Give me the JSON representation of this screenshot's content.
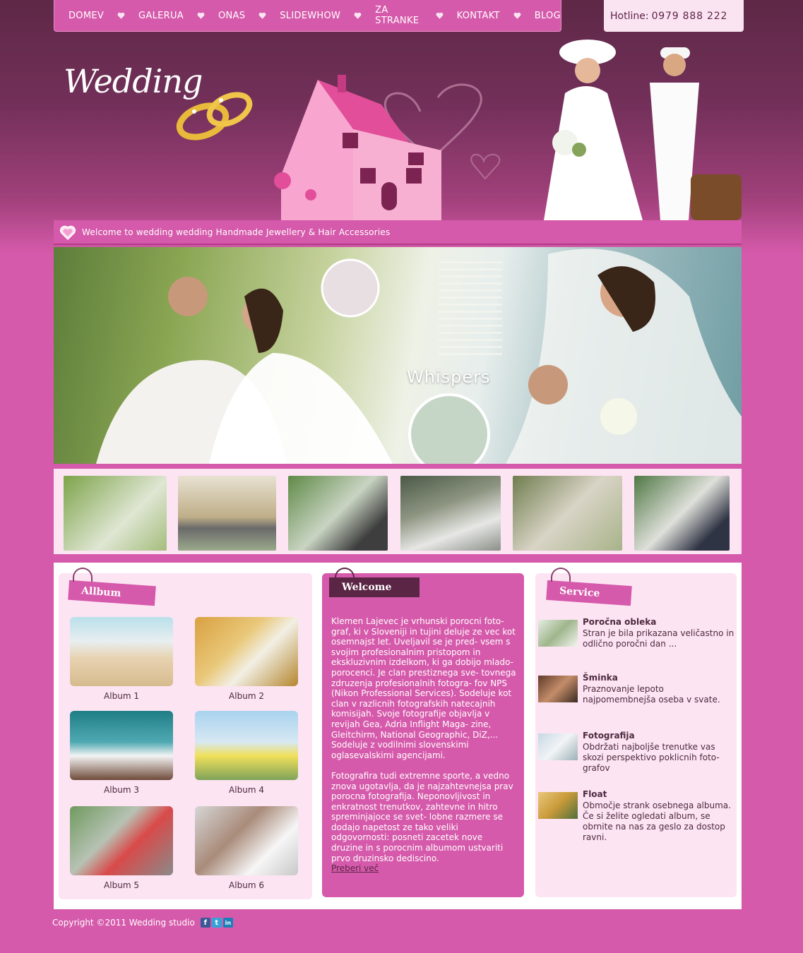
{
  "nav": {
    "items": [
      "DOMEV",
      "GALERUA",
      "ONAS",
      "SLIDEWHOW",
      "ZA STRANKE",
      "KONTAKT",
      "BLOG"
    ]
  },
  "hotline": {
    "label": "Hotline:",
    "number": "0979 888 222"
  },
  "header": {
    "logo": "Wedding"
  },
  "welcome_bar": {
    "text": "Welcome to wedding wedding Handmade Jewellery & Hair Accessories"
  },
  "banner": {
    "title": "Whispers"
  },
  "album": {
    "heading": "Allbum",
    "items": [
      {
        "label": "Album 1"
      },
      {
        "label": "Album 2"
      },
      {
        "label": "Album 3"
      },
      {
        "label": "Album 4"
      },
      {
        "label": "Album 5"
      },
      {
        "label": "Album 6"
      }
    ]
  },
  "welcome": {
    "heading": "Welcome",
    "paragraph1": "Klemen Lajevec je vrhunski porocni foto- graf, ki v Sloveniji in tujini deluje ze vec kot osemnajst let. Uveljavil se je pred- vsem s svojim profesionalnim pristopom in ekskluzivnim izdelkom, ki ga dobijo mlado- porocenci. Je clan prestiznega sve- tovnega zdruzenja profesionalnih fotogra- fov NPS (Nikon Professional Services). Sodeluje kot clan v razlicnih fotografskih natecajnih komisijah. Svoje fotografije objavlja v revijah Gea, Adria Inflight Maga- zine, Gleitchirm, National Geographic, DiZ,... Sodeluje z vodilnimi slovenskimi oglasevalskimi agencijami.",
    "paragraph2": "Fotografira tudi extremne sporte, a vedno znova ugotavlja, da je najzahtevnejsa prav porocna fotografija. Neponovljivost in enkratnost trenutkov, zahtevne in hitro spreminjajoce se svet- lobne razmere se dodajo napetost ze tako veliki odgovornosti: posneti zacetek nove druzine in s porocnim albumom ustvariti prvo druzinsko dediscino.",
    "read_more": "Preberi več"
  },
  "service": {
    "heading": "Service",
    "items": [
      {
        "title": "Poročna obleka",
        "desc": "Stran je bila prikazana veličastno in odlično poročni dan ..."
      },
      {
        "title": "Šminka",
        "desc": "Praznovanje lepoto najpomembnejša oseba v svate."
      },
      {
        "title": "Fotografija",
        "desc": "Obdržati najboljše trenutke vas skozi perspektivo poklicnih foto- grafov"
      },
      {
        "title": "Float",
        "desc": "Območje strank osebnega albuma. Če si želite ogledati album, se obrnite na nas za geslo za dostop ravni."
      }
    ]
  },
  "footer": {
    "copyright": "Copyright ©2011 Wedding studio"
  },
  "social": [
    {
      "icon": "facebook-icon",
      "glyph": "f",
      "color": "#3b5998"
    },
    {
      "icon": "twitter-icon",
      "glyph": "t",
      "color": "#33a3d8"
    },
    {
      "icon": "linkedin-icon",
      "glyph": "in",
      "color": "#1d7fb8"
    }
  ]
}
